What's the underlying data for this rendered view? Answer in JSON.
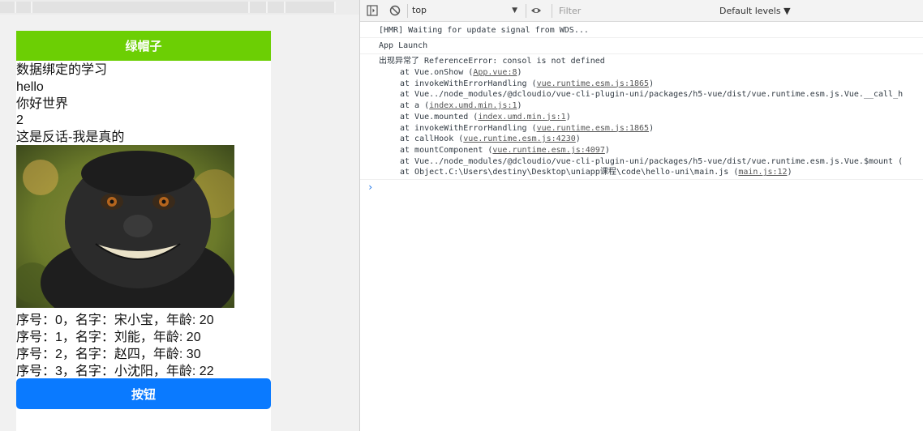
{
  "simulator": {
    "navbar_title": "绿帽子",
    "texts": [
      "数据绑定的学习",
      "hello",
      "你好世界",
      "2",
      "这是反话-我是真的"
    ],
    "people": [
      "序号：0，名字：宋小宝，年龄: 20",
      "序号：1，名字：刘能，年龄: 20",
      "序号：2，名字：赵四，年龄: 30",
      "序号：3，名字：小沈阳，年龄: 22"
    ],
    "button_label": "按钮"
  },
  "devtools": {
    "context": "top",
    "filter_placeholder": "Filter",
    "levels_label": "Default levels ▼",
    "logs": [
      "[HMR] Waiting for update signal from WDS...",
      "App Launch"
    ],
    "error": {
      "message": "出现异常了 ReferenceError: consol is not defined",
      "stack": [
        {
          "text": "at Vue.onShow (",
          "link": "App.vue:8",
          "tail": ")"
        },
        {
          "text": "at invokeWithErrorHandling (",
          "link": "vue.runtime.esm.js:1865",
          "tail": ")"
        },
        {
          "text": "at Vue../node_modules/@dcloudio/vue-cli-plugin-uni/packages/h5-vue/dist/vue.runtime.esm.js.Vue.__call_h",
          "link": "",
          "tail": ""
        },
        {
          "text": "at a (",
          "link": "index.umd.min.js:1",
          "tail": ")"
        },
        {
          "text": "at Vue.mounted (",
          "link": "index.umd.min.js:1",
          "tail": ")"
        },
        {
          "text": "at invokeWithErrorHandling (",
          "link": "vue.runtime.esm.js:1865",
          "tail": ")"
        },
        {
          "text": "at callHook (",
          "link": "vue.runtime.esm.js:4230",
          "tail": ")"
        },
        {
          "text": "at mountComponent (",
          "link": "vue.runtime.esm.js:4097",
          "tail": ")"
        },
        {
          "text": "at Vue../node_modules/@dcloudio/vue-cli-plugin-uni/packages/h5-vue/dist/vue.runtime.esm.js.Vue.$mount (",
          "link": "",
          "tail": ""
        },
        {
          "text": "at Object.C:\\Users\\destiny\\Desktop\\uniapp课程\\code\\hello-uni\\main.js (",
          "link": "main.js:12",
          "tail": ")"
        }
      ]
    },
    "prompt": "›"
  }
}
